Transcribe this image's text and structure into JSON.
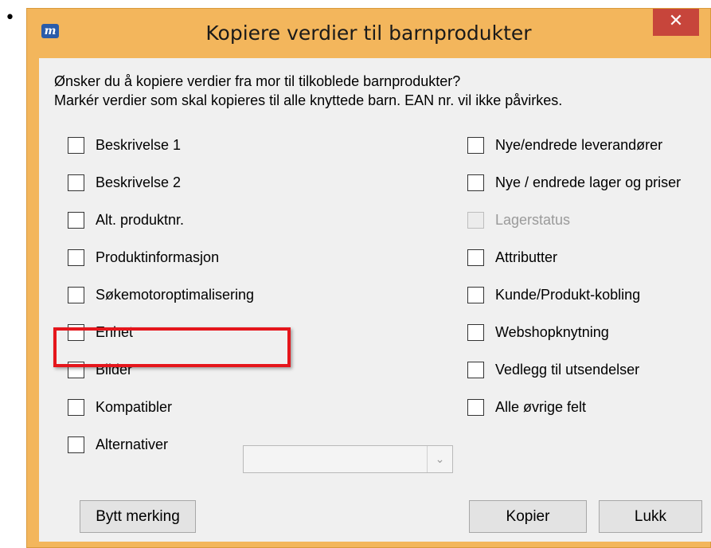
{
  "dialog": {
    "title": "Kopiere verdier til barnprodukter",
    "close_glyph": "✕",
    "app_icon_letter": "m",
    "intro_line1": "Ønsker du å kopiere verdier fra mor til tilkoblede barnprodukter?",
    "intro_line2": "Markér verdier som skal kopieres til alle knyttede barn. EAN nr. vil ikke påvirkes.",
    "bullet": "•",
    "left_options": [
      {
        "label": "Beskrivelse 1",
        "checked": false,
        "enabled": true
      },
      {
        "label": "Beskrivelse 2",
        "checked": false,
        "enabled": true
      },
      {
        "label": "Alt. produktnr.",
        "checked": false,
        "enabled": true
      },
      {
        "label": "Produktinformasjon",
        "checked": false,
        "enabled": true
      },
      {
        "label": "Søkemotoroptimalisering",
        "checked": false,
        "enabled": true
      },
      {
        "label": "Enhet",
        "checked": false,
        "enabled": true,
        "highlighted": true
      },
      {
        "label": "Bilder",
        "checked": false,
        "enabled": true
      },
      {
        "label": "Kompatibler",
        "checked": false,
        "enabled": true
      },
      {
        "label": "Alternativer",
        "checked": false,
        "enabled": true
      }
    ],
    "right_options": [
      {
        "label": "Nye/endrede leverandører",
        "checked": false,
        "enabled": true
      },
      {
        "label": "Nye / endrede lager og priser",
        "checked": false,
        "enabled": true
      },
      {
        "label": "Lagerstatus",
        "checked": false,
        "enabled": false
      },
      {
        "label": "Attributter",
        "checked": false,
        "enabled": true
      },
      {
        "label": "Kunde/Produkt-kobling",
        "checked": false,
        "enabled": true
      },
      {
        "label": "Webshopknytning",
        "checked": false,
        "enabled": true
      },
      {
        "label": "Vedlegg til utsendelser",
        "checked": false,
        "enabled": true
      },
      {
        "label": "Alle øvrige felt",
        "checked": false,
        "enabled": true
      }
    ],
    "alternatives_select_value": "",
    "buttons": {
      "toggle": "Bytt merking",
      "copy": "Kopier",
      "close": "Lukk"
    },
    "colors": {
      "window_frame": "#f3b65c",
      "client_bg": "#f0f0f0",
      "close_button": "#c7453b",
      "highlight_box": "#e5161c"
    }
  }
}
